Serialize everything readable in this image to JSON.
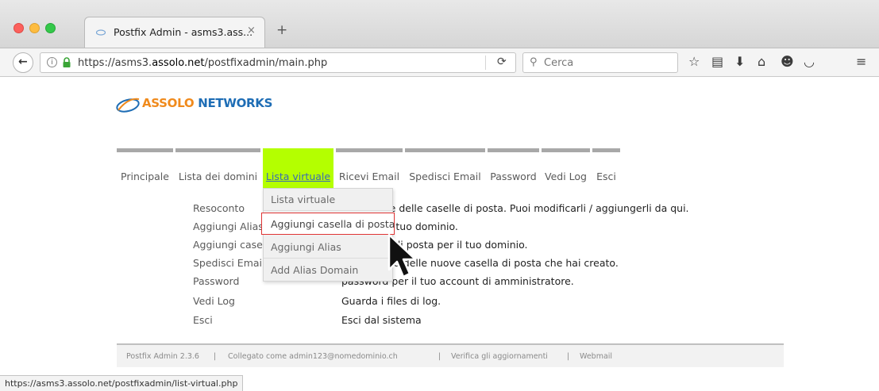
{
  "browser": {
    "tab_title": "Postfix Admin - asms3.ass...",
    "tab_close": "×",
    "new_tab": "+",
    "url_prefix": "https://asms3.",
    "url_domain": "assolo.net",
    "url_suffix": "/postfixadmin/main.php",
    "search_placeholder": "Cerca",
    "status_url": "https://asms3.assolo.net/postfixadmin/list-virtual.php"
  },
  "logo": {
    "part1": "ASSOLO",
    "part2": " NETWORKS"
  },
  "menu": [
    {
      "label": "Principale"
    },
    {
      "label": "Lista dei domini"
    },
    {
      "label": "Lista virtuale"
    },
    {
      "label": "Ricevi Email"
    },
    {
      "label": "Spedisci Email"
    },
    {
      "label": "Password"
    },
    {
      "label": "Vedi Log"
    },
    {
      "label": "Esci"
    }
  ],
  "dropdown": [
    {
      "label": "Lista virtuale"
    },
    {
      "label": "Aggiungi casella di posta"
    },
    {
      "label": "Aggiungi Alias"
    },
    {
      "label": "Add Alias Domain"
    }
  ],
  "overview": [
    {
      "name": "Resoconto",
      "desc": "tuoi alias e delle caselle di posta. Puoi modificarli / aggiungerli da qui."
    },
    {
      "name": "Aggiungi Alias",
      "desc": "alias per il tuo dominio."
    },
    {
      "name": "Aggiungi casel",
      "desc": "va casella di posta per il tuo dominio."
    },
    {
      "name": "Spedisci Email",
      "desc": "mail ad una delle nuove casella di posta che hai creato."
    },
    {
      "name": "Password",
      "desc": "password per il tuo account di amministratore."
    },
    {
      "name": "Vedi Log",
      "desc": "Guarda i files di log."
    },
    {
      "name": "Esci",
      "desc": "Esci dal sistema"
    }
  ],
  "footer": {
    "version": "Postfix Admin 2.3.6",
    "sep1": "|",
    "logged_in": "Collegato come admin123@nomedominio.ch",
    "sep2": "|",
    "check_updates": "Verifica gli aggiornamenti",
    "sep3": "|",
    "webmail": "Webmail"
  },
  "colors": {
    "menu_active": "#b4ff00",
    "hover_border": "#e03434",
    "link": "#3b6bb5"
  }
}
